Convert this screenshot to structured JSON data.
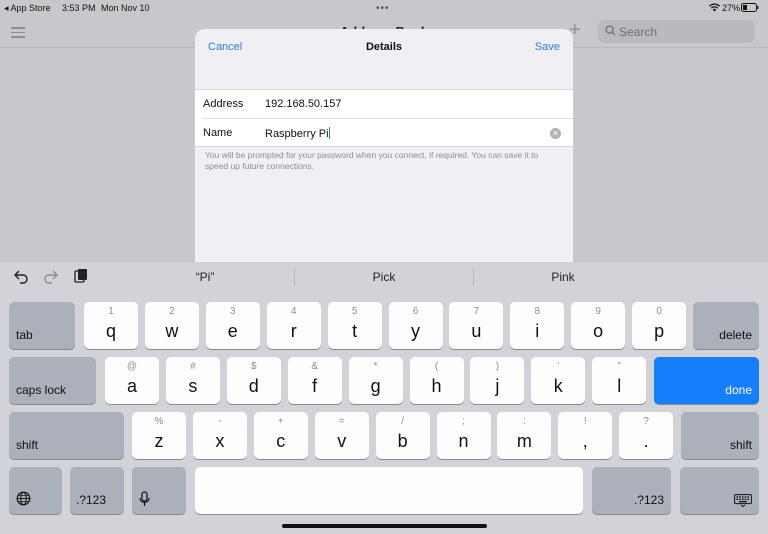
{
  "status_bar": {
    "back_app": "◂ App Store",
    "time": "3:53 PM",
    "date": "Mon Nov 10",
    "battery": "27%"
  },
  "background": {
    "title": "Address Book",
    "search_placeholder": "Search"
  },
  "sheet": {
    "cancel_label": "Cancel",
    "title": "Details",
    "save_label": "Save",
    "fields": [
      {
        "label": "Address",
        "value": "192.168.50.157"
      },
      {
        "label": "Name",
        "value": "Raspberry Pi"
      }
    ],
    "help_text": "You will be prompted for your password when you connect, if required. You can save it to speed up future connections."
  },
  "keyboard": {
    "suggestions": [
      "“Pi”",
      "Pick",
      "Pink"
    ],
    "row1": {
      "tab": "tab",
      "keys": [
        {
          "alt": "1",
          "main": "q"
        },
        {
          "alt": "2",
          "main": "w"
        },
        {
          "alt": "3",
          "main": "e"
        },
        {
          "alt": "4",
          "main": "r"
        },
        {
          "alt": "5",
          "main": "t"
        },
        {
          "alt": "6",
          "main": "y"
        },
        {
          "alt": "7",
          "main": "u"
        },
        {
          "alt": "8",
          "main": "i"
        },
        {
          "alt": "9",
          "main": "o"
        },
        {
          "alt": "0",
          "main": "p"
        }
      ],
      "delete": "delete"
    },
    "row2": {
      "caps": "caps lock",
      "keys": [
        {
          "alt": "@",
          "main": "a"
        },
        {
          "alt": "#",
          "main": "s"
        },
        {
          "alt": "$",
          "main": "d"
        },
        {
          "alt": "&",
          "main": "f"
        },
        {
          "alt": "*",
          "main": "g"
        },
        {
          "alt": "(",
          "main": "h"
        },
        {
          "alt": ")",
          "main": "j"
        },
        {
          "alt": "’",
          "main": "k"
        },
        {
          "alt": "”",
          "main": "l"
        }
      ],
      "done": "done"
    },
    "row3": {
      "shift_left": "shift",
      "keys": [
        {
          "alt": "%",
          "main": "z"
        },
        {
          "alt": "-",
          "main": "x"
        },
        {
          "alt": "+",
          "main": "c"
        },
        {
          "alt": "=",
          "main": "v"
        },
        {
          "alt": "/",
          "main": "b"
        },
        {
          "alt": ";",
          "main": "n"
        },
        {
          "alt": ":",
          "main": "m"
        },
        {
          "alt": "!",
          "main": ","
        },
        {
          "alt": "?",
          "main": "."
        }
      ],
      "shift_right": "shift"
    },
    "row4": {
      "numbers_left": ".?123",
      "numbers_right": ".?123"
    }
  },
  "colors": {
    "accent": "#2f7bd9",
    "done_key": "#147efb"
  }
}
